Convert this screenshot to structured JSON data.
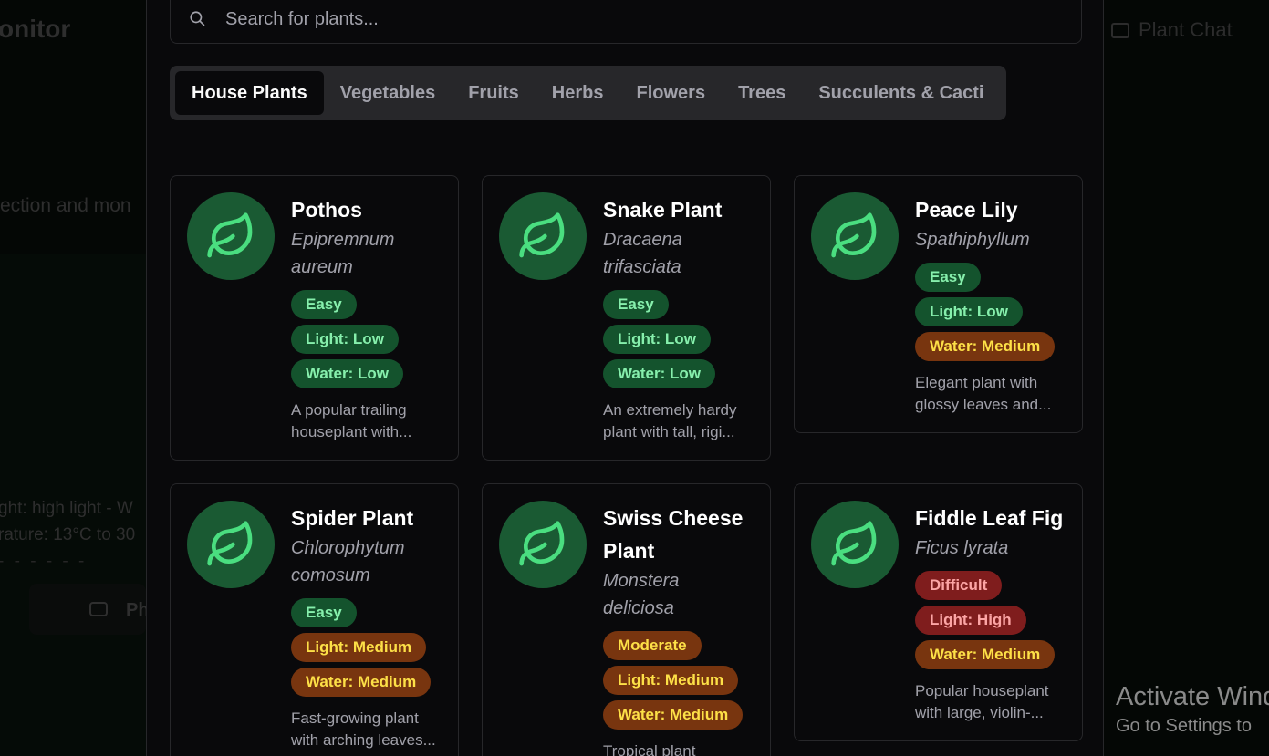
{
  "background": {
    "title": "onitor",
    "description": "ection and mon",
    "light_line": "ght: high light - W",
    "temp_line": "rature: 13°C to 30",
    "photo_label": "Ph",
    "chat_label": "Plant Chat"
  },
  "watermark": {
    "line1": "Activate Wind",
    "line2": "Go to Settings to"
  },
  "search": {
    "placeholder": "Search for plants..."
  },
  "tabs": [
    {
      "label": "House Plants"
    },
    {
      "label": "Vegetables"
    },
    {
      "label": "Fruits"
    },
    {
      "label": "Herbs"
    },
    {
      "label": "Flowers"
    },
    {
      "label": "Trees"
    },
    {
      "label": "Succulents & Cacti"
    }
  ],
  "active_tab": "House Plants",
  "plants": [
    {
      "name": "Pothos",
      "scientific": "Epipremnum aureum",
      "difficulty": {
        "label": "Easy",
        "tone": "green"
      },
      "light": {
        "label": "Light: Low",
        "tone": "green"
      },
      "water": {
        "label": "Water: Low",
        "tone": "green"
      },
      "description": "A popular trailing houseplant with..."
    },
    {
      "name": "Snake Plant",
      "scientific": "Dracaena trifasciata",
      "difficulty": {
        "label": "Easy",
        "tone": "green"
      },
      "light": {
        "label": "Light: Low",
        "tone": "green"
      },
      "water": {
        "label": "Water: Low",
        "tone": "green"
      },
      "description": "An extremely hardy plant with tall, rigi..."
    },
    {
      "name": "Peace Lily",
      "scientific": "Spathiphyllum",
      "difficulty": {
        "label": "Easy",
        "tone": "green"
      },
      "light": {
        "label": "Light: Low",
        "tone": "green"
      },
      "water": {
        "label": "Water: Medium",
        "tone": "amber"
      },
      "description": "Elegant plant with glossy leaves and..."
    },
    {
      "name": "Spider Plant",
      "scientific": "Chlorophytum comosum",
      "difficulty": {
        "label": "Easy",
        "tone": "green"
      },
      "light": {
        "label": "Light: Medium",
        "tone": "amber"
      },
      "water": {
        "label": "Water: Medium",
        "tone": "amber"
      },
      "description": "Fast-growing plant with arching leaves..."
    },
    {
      "name": "Swiss Cheese Plant",
      "scientific": "Monstera deliciosa",
      "difficulty": {
        "label": "Moderate",
        "tone": "amber"
      },
      "light": {
        "label": "Light: Medium",
        "tone": "amber"
      },
      "water": {
        "label": "Water: Medium",
        "tone": "amber"
      },
      "description": "Tropical plant"
    },
    {
      "name": "Fiddle Leaf Fig",
      "scientific": "Ficus lyrata",
      "difficulty": {
        "label": "Difficult",
        "tone": "red"
      },
      "light": {
        "label": "Light: High",
        "tone": "red"
      },
      "water": {
        "label": "Water: Medium",
        "tone": "amber"
      },
      "description": "Popular houseplant with large, violin-..."
    }
  ],
  "colors": {
    "dialog_bg": "#09090b",
    "border": "#27272a",
    "avatar_bg": "#1a5a33",
    "leaf_icon": "#4ade80",
    "green_badge_bg": "#14532d",
    "green_badge_text": "#86efac",
    "amber_badge_bg": "#78350f",
    "amber_badge_text": "#fde047",
    "red_badge_bg": "#7f1d1d",
    "red_badge_text": "#fca5a5"
  },
  "icons": {
    "search": "search-icon",
    "plant": "leaf-icon",
    "chat": "message-square-icon",
    "camera": "camera-icon"
  }
}
